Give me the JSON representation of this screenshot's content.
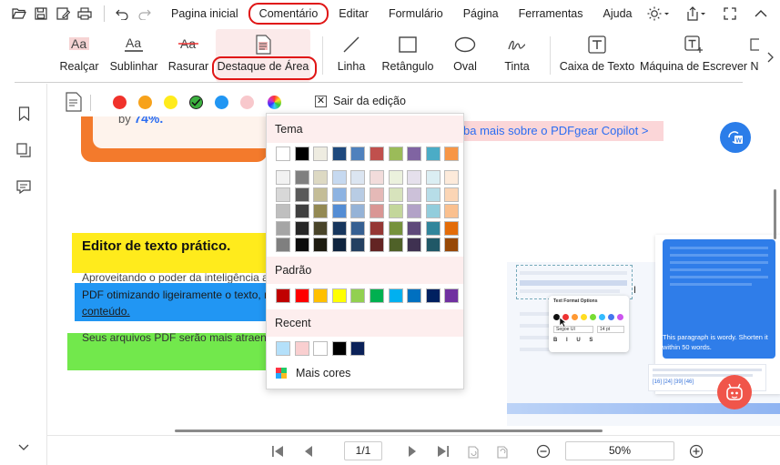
{
  "menubar": {
    "items": [
      "Pagina inicial",
      "Comentário",
      "Editar",
      "Formulário",
      "Página",
      "Ferramentas",
      "Ajuda"
    ],
    "active": "Comentário"
  },
  "ribbon": {
    "tools": [
      {
        "label": "Realçar",
        "icon": "highlight-text-icon"
      },
      {
        "label": "Sublinhar",
        "icon": "underline-text-icon"
      },
      {
        "label": "Rasurar",
        "icon": "strikethrough-text-icon"
      },
      {
        "label": "Destaque de Área",
        "icon": "area-highlight-icon"
      },
      {
        "label": "Linha",
        "icon": "line-icon"
      },
      {
        "label": "Retângulo",
        "icon": "rectangle-icon"
      },
      {
        "label": "Oval",
        "icon": "oval-icon"
      },
      {
        "label": "Tinta",
        "icon": "ink-icon"
      },
      {
        "label": "Caixa de Texto",
        "icon": "text-box-icon"
      },
      {
        "label": "Máquina de Escrever",
        "icon": "typewriter-icon"
      },
      {
        "label": "N",
        "icon": "more-tool-icon"
      }
    ],
    "selected": "Destaque de Área"
  },
  "colorbar": {
    "swatches": [
      "#f0322b",
      "#f7a21b",
      "#ffeb1c",
      "#3cb23f",
      "#2196f3",
      "#f8c8cc"
    ],
    "selected": "#3cb23f",
    "exit_label": "Sair da edição"
  },
  "document": {
    "partial_text": "by",
    "partial_percent": "74%.",
    "link_text": "ba mais sobre o PDFgear Copilot >",
    "heading": "Editor de texto prático.",
    "para1_line1": "Aproveitando o poder da inteligência a",
    "para1_line2": "PDF otimizando ligeiramente o texto, n",
    "para1_line3": "conteúdo.",
    "para2": "Seus arquivos PDF serão mais atraente",
    "mock_panel_title": "Text Format Options",
    "mock_font": "Segoe UI",
    "mock_size": "14 pt",
    "mock_chat": "This paragraph is wordy. Shorten it within 50 words.",
    "mock_refs": "[16] [24] [39] [46]"
  },
  "picker": {
    "theme_label": "Tema",
    "standard_label": "Padrão",
    "recent_label": "Recent",
    "more_label": "Mais cores",
    "theme_top": [
      "#ffffff",
      "#000000",
      "#eeece1",
      "#1f497d",
      "#4f81bd",
      "#c0504d",
      "#9bbb59",
      "#8064a2",
      "#4bacc6",
      "#f79646"
    ],
    "theme_shades": [
      [
        "#f2f2f2",
        "#7f7f7f",
        "#ddd9c3",
        "#c6d9f0",
        "#dbe5f1",
        "#f2dcdb",
        "#ebf1dd",
        "#e5e0ec",
        "#dbeef3",
        "#fdeada"
      ],
      [
        "#d8d8d8",
        "#595959",
        "#c4bd97",
        "#8db3e2",
        "#b8cce4",
        "#e5b9b7",
        "#d7e3bc",
        "#ccc1d9",
        "#b7dde8",
        "#fbd5b5"
      ],
      [
        "#bfbfbf",
        "#3f3f3f",
        "#938953",
        "#548dd4",
        "#95b3d7",
        "#d99694",
        "#c3d69b",
        "#b2a2c7",
        "#92cddc",
        "#fac08f"
      ],
      [
        "#a5a5a5",
        "#262626",
        "#494429",
        "#17365d",
        "#366092",
        "#953734",
        "#76923c",
        "#5f497a",
        "#31859b",
        "#e36c09"
      ],
      [
        "#7f7f7f",
        "#0c0c0c",
        "#1d1b10",
        "#0f243e",
        "#244061",
        "#632423",
        "#4f6128",
        "#3f3151",
        "#205867",
        "#974806"
      ]
    ],
    "standard": [
      "#c00000",
      "#ff0000",
      "#ffc000",
      "#ffff00",
      "#92d050",
      "#00b050",
      "#00b0f0",
      "#0070c0",
      "#002060",
      "#7030a0"
    ],
    "recent": [
      "#b4e0fa",
      "#f9cfd0",
      "#ffffff",
      "#000000",
      "#0b2158"
    ]
  },
  "bottombar": {
    "page": "1/1",
    "zoom": "50%"
  }
}
